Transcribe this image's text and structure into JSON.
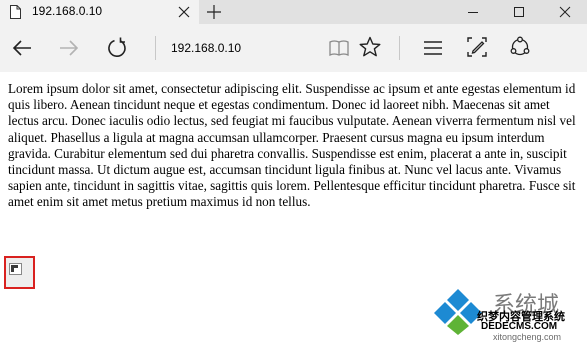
{
  "tab": {
    "title": "192.168.0.10",
    "favicon": "page-icon"
  },
  "window_controls": {
    "new_tab_icon": "plus-icon",
    "minimize_icon": "minimize-icon",
    "maximize_icon": "maximize-icon",
    "close_icon": "close-icon"
  },
  "navigation": {
    "address": "192.168.0.10",
    "icons": [
      "back-arrow-icon",
      "forward-arrow-icon",
      "refresh-icon",
      "reading-view-icon",
      "favorite-star-icon",
      "hub-menu-icon",
      "web-note-icon",
      "share-icon"
    ]
  },
  "page": {
    "paragraph": "Lorem ipsum dolor sit amet, consectetur adipiscing elit. Suspendisse ac ipsum et ante egestas elementum id quis libero. Aenean tincidunt neque et egestas condimentum. Donec id laoreet nibh. Maecenas sit amet lectus arcu. Donec iaculis odio lectus, sed feugiat mi faucibus vulputate. Aenean viverra fermentum nisl vel aliquet. Phasellus a ligula at magna accumsan ullamcorper. Praesent cursus magna eu ipsum interdum gravida. Curabitur elementum sed dui pharetra convallis. Suspendisse est enim, placerat a ante in, suscipit tincidunt massa. Ut dictum augue est, accumsan tincidunt ligula finibus at. Nunc vel lacus ante. Vivamus sapien ante, tincidunt in sagittis vitae, sagittis quis lorem. Pellentesque efficitur tincidunt pharetra. Fusce sit amet enim sit amet metus pretium maximus id non tellus.",
    "broken_image_icon": "broken-image-icon",
    "highlight_color": "#d9211f"
  },
  "watermark": {
    "name": "系统城",
    "caption": "织梦内容管理系统",
    "domain": "DEDECMS.COM",
    "url": "xitongcheng.com",
    "logo_color": "#1d8ad3"
  }
}
